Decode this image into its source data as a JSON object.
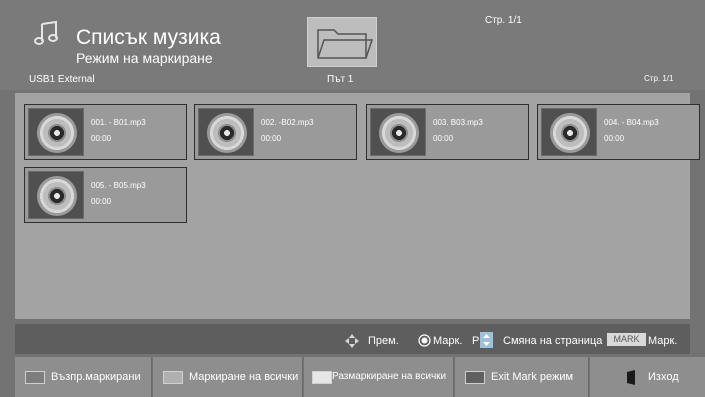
{
  "header": {
    "title": "Списък музика",
    "subtitle": "Режим на маркиране",
    "device": "USB1 External",
    "path_label": "Път 1",
    "page_top": "Стр. 1/1",
    "page_right": "Стр. 1/1"
  },
  "files": [
    {
      "name": "001. - B01.mp3",
      "time": "00:00"
    },
    {
      "name": "002. -B02.mp3",
      "time": "00:00"
    },
    {
      "name": "003. B03.mp3",
      "time": "00:00"
    },
    {
      "name": "004. - B04.mp3",
      "time": "00:00"
    },
    {
      "name": "005. - B05.mp3",
      "time": "00:00"
    }
  ],
  "hints": {
    "move": "Прем.",
    "mark": "Марк.",
    "page_key": "P",
    "page_change": "Смяна на страница",
    "mark_key": "MARK",
    "mark2": "Марк."
  },
  "buttons": [
    {
      "label": "Възпр.маркирани",
      "color": "#7d7d7d"
    },
    {
      "label": "Маркиране на всички",
      "color": "#b0b0b0"
    },
    {
      "label": "Размаркиране на всички",
      "color": "#e6e6e6"
    },
    {
      "label": "Exit Mark режим",
      "color": "#606060"
    },
    {
      "label": "Изход",
      "icon": "exit-door-icon"
    }
  ]
}
